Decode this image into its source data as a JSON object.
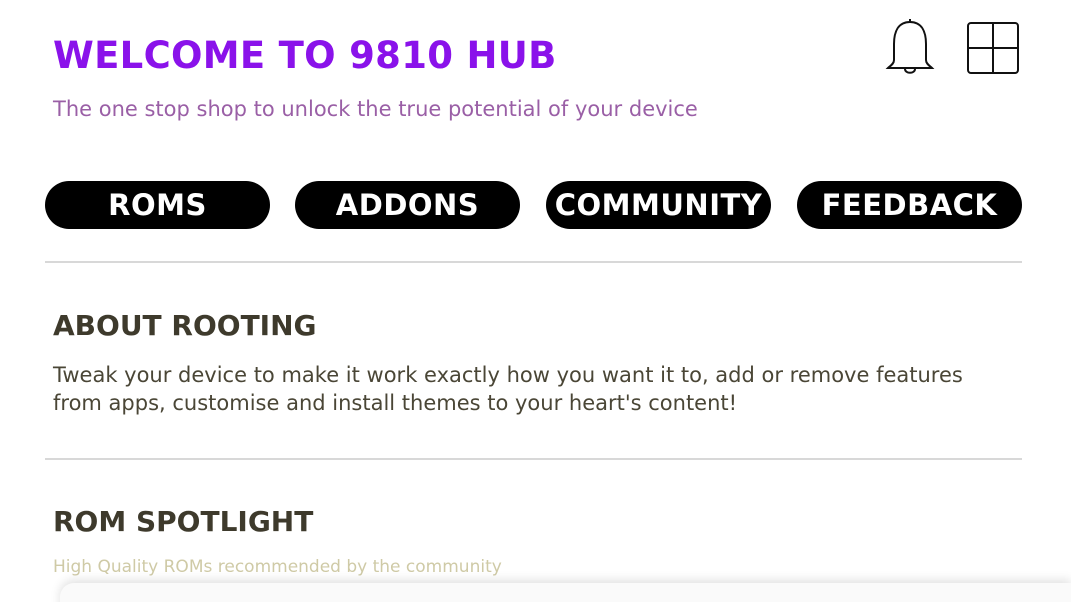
{
  "header": {
    "title": "WELCOME TO 9810 HUB",
    "subtitle": "The one stop shop to unlock the true potential of your device",
    "icons": [
      "bell-icon",
      "grid-menu-icon"
    ]
  },
  "nav": {
    "items": [
      {
        "label": "ROMS"
      },
      {
        "label": "ADDONS"
      },
      {
        "label": "COMMUNITY"
      },
      {
        "label": "FEEDBACK"
      }
    ]
  },
  "sections": {
    "about": {
      "title": "ABOUT ROOTING",
      "body": "Tweak your device to make it work exactly how you want it to, add or remove features from apps, customise and install themes to your heart's content!"
    },
    "spotlight": {
      "title": "ROM SPOTLIGHT",
      "subtitle": "High Quality ROMs recommended by the community"
    }
  },
  "colors": {
    "title": "#8a12ea",
    "subtitle": "#9a5fa6",
    "nav_bg": "#000000",
    "nav_text": "#ffffff",
    "section_title": "#3e3a2c",
    "section_sub": "#cfcaa6"
  }
}
